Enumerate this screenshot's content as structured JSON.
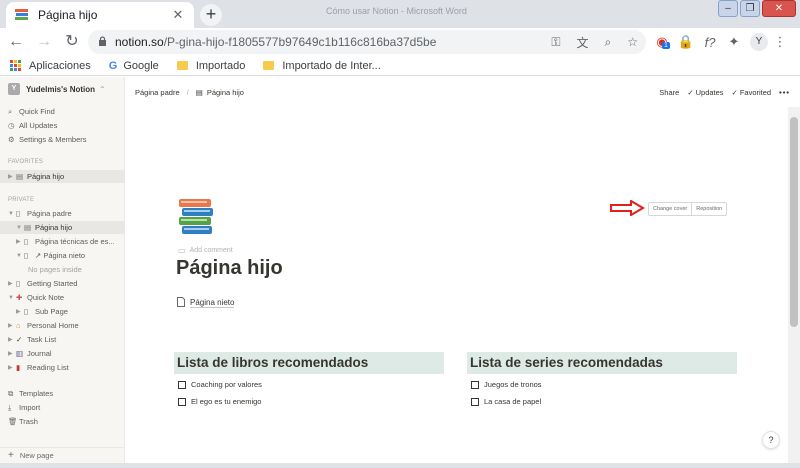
{
  "browser": {
    "tab_title": "Página hijo",
    "tab_close": "✕",
    "new_tab": "+",
    "ghost_title": "Cómo usar Notion - Microsoft Word",
    "url_host": "notion.so",
    "url_path": "/P-gina-hijo-f1805577b97649c1b116c816ba37d5be",
    "avatar_letter": "Y",
    "ext_badge": "1",
    "window_buttons": [
      "–",
      "❐",
      "✕"
    ]
  },
  "bookmarks": {
    "items": [
      {
        "label": "Aplicaciones",
        "icon": "apps-grid-icon"
      },
      {
        "label": "Google",
        "icon": "google-g-icon"
      },
      {
        "label": "Importado",
        "icon": "folder-icon"
      },
      {
        "label": "Importado de Inter...",
        "icon": "folder-icon"
      }
    ]
  },
  "sidebar": {
    "workspace": "Yudelmis's Notion",
    "workspace_initial": "Y",
    "top_items": [
      {
        "label": "Quick Find",
        "icon": "search-icon"
      },
      {
        "label": "All Updates",
        "icon": "clock-icon"
      },
      {
        "label": "Settings & Members",
        "icon": "gear-icon"
      }
    ],
    "favorites_title": "FAVORITES",
    "favorites": [
      {
        "label": "Página hijo",
        "icon": "books-icon"
      }
    ],
    "private_title": "PRIVATE",
    "private": [
      {
        "label": "Página padre",
        "icon": "page-icon"
      },
      {
        "label": "Página hijo",
        "icon": "books-icon"
      },
      {
        "label": "Página técnicas de es...",
        "icon": "page-icon"
      },
      {
        "label": "↗ Página nieto",
        "icon": "page-icon"
      },
      {
        "label": "No pages inside",
        "icon": ""
      },
      {
        "label": "Getting Started",
        "icon": "page-icon"
      },
      {
        "label": "Quick Note",
        "icon": "pin-icon"
      },
      {
        "label": "Sub Page",
        "icon": "page-icon"
      },
      {
        "label": "Personal Home",
        "icon": "house-icon"
      },
      {
        "label": "Task List",
        "icon": "check-icon"
      },
      {
        "label": "Journal",
        "icon": "notebook-icon"
      },
      {
        "label": "Reading List",
        "icon": "book-icon"
      }
    ],
    "bottom_items": [
      {
        "label": "Templates",
        "icon": "templates-icon"
      },
      {
        "label": "Import",
        "icon": "import-icon"
      },
      {
        "label": "Trash",
        "icon": "trash-icon"
      }
    ],
    "new_page": "New page"
  },
  "topbar": {
    "breadcrumb": [
      "Página padre",
      "Página hijo"
    ],
    "share": "Share",
    "updates": "Updates",
    "favorited": "Favorited",
    "more": "•••"
  },
  "page": {
    "add_comment": "Add comment",
    "title": "Página hijo",
    "subpage": "Página nieto",
    "change_cover": "Change cover",
    "reposition": "Reposition",
    "columns": [
      {
        "heading": "Lista de libros recomendados",
        "todos": [
          "Coaching por valores",
          "El ego es tu enemigo"
        ]
      },
      {
        "heading": "Lista de series recomendadas",
        "todos": [
          "Juegos de tronos",
          "La casa de papel"
        ]
      }
    ],
    "help": "?"
  },
  "colors": {
    "heading_bg": "#ddeae6",
    "arrow": "#e02020",
    "sidebar_bg": "#f7f6f3"
  }
}
